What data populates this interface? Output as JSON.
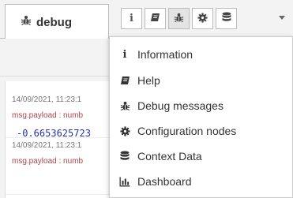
{
  "sidebar": {
    "active_tab": {
      "label": "debug",
      "icon": "bug-icon"
    },
    "toolbar_buttons": [
      {
        "name": "info-button",
        "icon": "info-icon",
        "glyph": "i"
      },
      {
        "name": "help-button",
        "icon": "book-icon"
      },
      {
        "name": "debug-button",
        "icon": "bug-icon",
        "active": true
      },
      {
        "name": "config-button",
        "icon": "gear-icon"
      },
      {
        "name": "context-button",
        "icon": "database-icon"
      }
    ],
    "dropdown_icon": "chevron-down-icon"
  },
  "debug_messages": [
    {
      "timestamp": "14/09/2021, 11:23:1",
      "topic": "msg.payload : numb",
      "value": "-0.6653625723"
    },
    {
      "timestamp": "14/09/2021, 11:23:1",
      "topic": "msg.payload : numb"
    }
  ],
  "menu": {
    "items": [
      {
        "label": "Information",
        "icon": "info-icon",
        "glyph": "i"
      },
      {
        "label": "Help",
        "icon": "book-icon"
      },
      {
        "label": "Debug messages",
        "icon": "bug-icon"
      },
      {
        "label": "Configuration nodes",
        "icon": "gear-icon"
      },
      {
        "label": "Context Data",
        "icon": "database-icon"
      },
      {
        "label": "Dashboard",
        "icon": "bar-chart-icon"
      }
    ]
  },
  "colors": {
    "panel_bg": "#f3f3f3",
    "border": "#bbbbbb",
    "text": "#333333",
    "topic_text": "#aa4444",
    "value_text": "#2233aa"
  }
}
